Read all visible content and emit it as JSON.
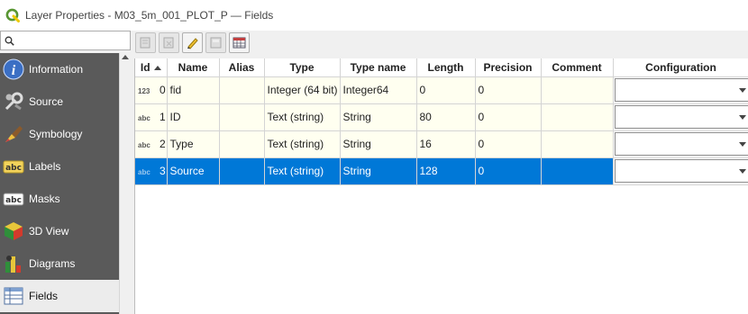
{
  "window": {
    "title": "Layer Properties - M03_5m_001_PLOT_P — Fields"
  },
  "search": {
    "placeholder": "",
    "value": ""
  },
  "sidebar": {
    "items": [
      {
        "label": "Information",
        "icon": "info-icon",
        "active": false
      },
      {
        "label": "Source",
        "icon": "source-icon",
        "active": false
      },
      {
        "label": "Symbology",
        "icon": "symbology-icon",
        "active": false
      },
      {
        "label": "Labels",
        "icon": "labels-icon",
        "active": false
      },
      {
        "label": "Masks",
        "icon": "masks-icon",
        "active": false
      },
      {
        "label": "3D View",
        "icon": "3d-view-icon",
        "active": false
      },
      {
        "label": "Diagrams",
        "icon": "diagrams-icon",
        "active": false
      },
      {
        "label": "Fields",
        "icon": "fields-icon",
        "active": true
      }
    ]
  },
  "toolbar": {
    "buttons": [
      {
        "icon": "new-field-icon",
        "enabled": false
      },
      {
        "icon": "delete-field-icon",
        "enabled": false
      },
      {
        "icon": "toggle-editing-icon",
        "enabled": true
      },
      {
        "icon": "field-calculator-icon",
        "enabled": false
      },
      {
        "icon": "field-table-icon",
        "enabled": true
      }
    ]
  },
  "table": {
    "headers": [
      "Id",
      "Name",
      "Alias",
      "Type",
      "Type name",
      "Length",
      "Precision",
      "Comment",
      "Configuration"
    ],
    "rows": [
      {
        "badge": "123",
        "id": "0",
        "name": "fid",
        "alias": "",
        "type": "Integer (64 bit)",
        "type_name": "Integer64",
        "length": "0",
        "precision": "0",
        "comment": "",
        "configuration": ""
      },
      {
        "badge": "abc",
        "id": "1",
        "name": "ID",
        "alias": "",
        "type": "Text (string)",
        "type_name": "String",
        "length": "80",
        "precision": "0",
        "comment": "",
        "configuration": ""
      },
      {
        "badge": "abc",
        "id": "2",
        "name": "Type",
        "alias": "",
        "type": "Text (string)",
        "type_name": "String",
        "length": "16",
        "precision": "0",
        "comment": "",
        "configuration": ""
      },
      {
        "badge": "abc",
        "id": "3",
        "name": "Source",
        "alias": "",
        "type": "Text (string)",
        "type_name": "String",
        "length": "128",
        "precision": "0",
        "comment": "",
        "configuration": ""
      }
    ],
    "selected_row": 3
  },
  "colors": {
    "sidebar_bg": "#5a5a5a",
    "selection": "#0078d7",
    "row_bg": "#fffff0",
    "qgis_green": "#589632",
    "qgis_yellow": "#eec900"
  }
}
